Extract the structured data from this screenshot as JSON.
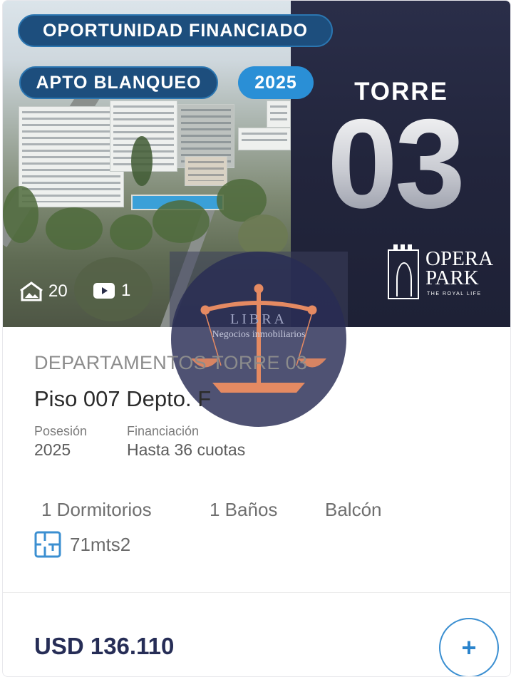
{
  "badges": {
    "offer": "OPORTUNIDAD FINANCIADO",
    "blanqueo": "APTO BLANQUEO",
    "year": "2025"
  },
  "tower": {
    "label": "TORRE",
    "number": "03"
  },
  "brand": {
    "line1": "OPERA",
    "line2": "PARK",
    "tagline": "THE ROYAL LIFE"
  },
  "media": {
    "photos": "20",
    "videos": "1"
  },
  "watermark": {
    "name": "LIBRA",
    "subtitle": "Negocios inmobiliarios"
  },
  "listing": {
    "category": "DEPARTAMENTOS TORRE 03",
    "title": "Piso 007 Depto. F",
    "possession_label": "Posesión",
    "possession_value": "2025",
    "financing_label": "Financiación",
    "financing_value": "Hasta 36 cuotas",
    "bedrooms": "1 Dormitorios",
    "bathrooms": "1 Baños",
    "balcony": "Balcón",
    "area": "71mts2",
    "price": "USD 136.110"
  },
  "actions": {
    "add": "+"
  },
  "colors": {
    "navy_pill": "#1d4e7d",
    "blue_pill": "#2a8fd6",
    "dark_panel": "#22253c",
    "price": "#262d56",
    "accent": "#3b8fd1"
  }
}
